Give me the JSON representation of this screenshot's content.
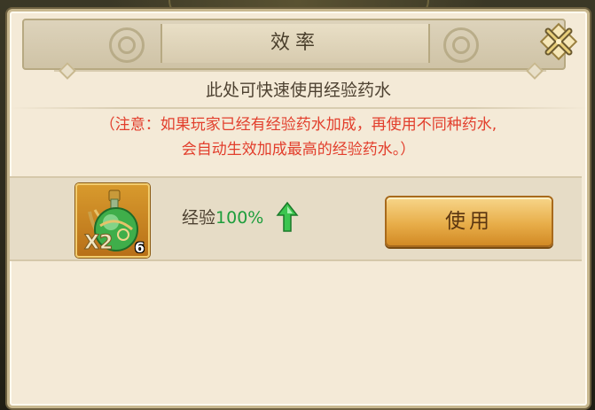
{
  "dialog": {
    "title": "效率",
    "subtitle": "此处可快速使用经验药水",
    "notice_line1": "（注意：如果玩家已经有经验药水加成，再使用不同种药水,",
    "notice_line2": "会自动生效加成最高的经验药水。）"
  },
  "item": {
    "icon": "green-potion-icon",
    "multiplier_text": "X2",
    "count": "6",
    "effect_label": "经验",
    "effect_value": "100%",
    "use_label": "使用"
  },
  "colors": {
    "notice": "#e23e2c",
    "effect_value": "#1e9e3c",
    "panel_bg": "#f4ead7",
    "button_gold": "#e8ae4a"
  }
}
